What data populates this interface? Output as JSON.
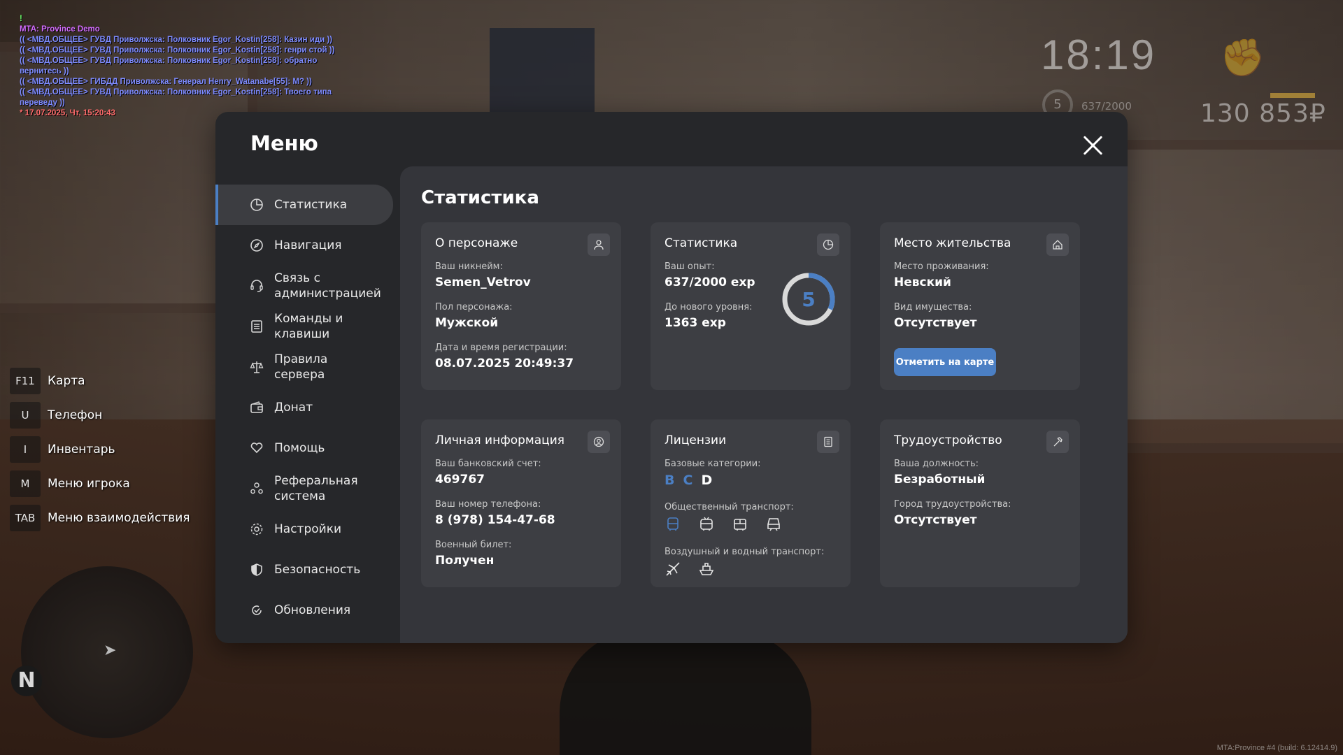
{
  "chat": {
    "lines": [
      {
        "text": "!",
        "color": "green"
      },
      {
        "text": "MTA: Province Demo",
        "color": "title"
      },
      {
        "text": "(( <МВД.ОБЩЕЕ> ГУВД Приволжска: Полковник Egor_Kostin[258]: Казин иди ))",
        "color": "blue"
      },
      {
        "text": "(( <МВД.ОБЩЕЕ> ГУВД Приволжска: Полковник Egor_Kostin[258]: генри стой ))",
        "color": "blue"
      },
      {
        "text": "(( <МВД.ОБЩЕЕ> ГУВД Приволжска: Полковник Egor_Kostin[258]: обратно вернитесь ))",
        "color": "blue"
      },
      {
        "text": "(( <МВД.ОБЩЕЕ> ГИБДД Приволжска: Генерал Henry_Watanabe[55]: М? ))",
        "color": "blue"
      },
      {
        "text": "(( <МВД.ОБЩЕЕ> ГУВД Приволжска: Полковник Egor_Kostin[258]: Твоего типа переведу ))",
        "color": "blue"
      },
      {
        "text": "* 17.07.2025, Чт, 15:20:43",
        "color": "red"
      }
    ]
  },
  "hud": {
    "time": "18:19",
    "level": "5",
    "exp": "637/2000",
    "money": "130 853₽",
    "fist_icon": "fist-icon"
  },
  "shortcuts": [
    {
      "key": "F11",
      "label": "Карта"
    },
    {
      "key": "U",
      "label": "Телефон"
    },
    {
      "key": "I",
      "label": "Инвентарь"
    },
    {
      "key": "M",
      "label": "Меню игрока"
    },
    {
      "key": "TAB",
      "label": "Меню взаимодействия"
    }
  ],
  "minimap": {
    "north": "N"
  },
  "build": "MTA:Province #4 (build: 6.12414.9)",
  "menu": {
    "title": "Меню",
    "nav": [
      {
        "label": "Статистика",
        "icon": "pie-chart-icon",
        "active": true
      },
      {
        "label": "Навигация",
        "icon": "compass-icon"
      },
      {
        "label": "Связь с администрацией",
        "icon": "headset-icon"
      },
      {
        "label": "Команды и клавиши",
        "icon": "list-icon"
      },
      {
        "label": "Правила сервера",
        "icon": "scales-icon"
      },
      {
        "label": "Донат",
        "icon": "wallet-icon"
      },
      {
        "label": "Помощь",
        "icon": "heart-hands-icon"
      },
      {
        "label": "Реферальная система",
        "icon": "people-icon"
      },
      {
        "label": "Настройки",
        "icon": "gear-icon"
      },
      {
        "label": "Безопасность",
        "icon": "shield-icon"
      },
      {
        "label": "Обновления",
        "icon": "refresh-icon"
      }
    ],
    "content_title": "Статистика",
    "character": {
      "title": "О персонаже",
      "nick_label": "Ваш никнейм:",
      "nick": "Semen_Vetrov",
      "gender_label": "Пол персонажа:",
      "gender": "Мужской",
      "reg_label": "Дата и время регистрации:",
      "reg": "08.07.2025 20:49:37"
    },
    "stats": {
      "title": "Статистика",
      "exp_label": "Ваш опыт:",
      "exp": "637/2000 exp",
      "next_label": "До нового уровня:",
      "next": "1363 exp",
      "level": "5",
      "progress": 0.3185,
      "ring_color": "#4b7fc4"
    },
    "residence": {
      "title": "Место жительства",
      "place_label": "Место проживания:",
      "place": "Невский",
      "property_label": "Вид имущества:",
      "property": "Отсутствует",
      "button": "Отметить на карте"
    },
    "personal": {
      "title": "Личная информация",
      "bank_label": "Ваш банковский счет:",
      "bank": "469767",
      "phone_label": "Ваш номер телефона:",
      "phone": "8 (978) 154-47-68",
      "military_label": "Военный билет:",
      "military": "Получен"
    },
    "licenses": {
      "title": "Лицензии",
      "base_label": "Базовые категории:",
      "categories": [
        {
          "letter": "B",
          "color": "#4b7fc4"
        },
        {
          "letter": "C",
          "color": "#4b7fc4"
        },
        {
          "letter": "D",
          "color": "#ffffff"
        }
      ],
      "public_label": "Общественный транспорт:",
      "public_icons": [
        "bus-icon",
        "trolleybus-icon",
        "tram-icon",
        "train-icon"
      ],
      "air_label": "Воздушный и водный транспорт:",
      "air_icons": [
        "plane-icon",
        "ship-icon"
      ]
    },
    "job": {
      "title": "Трудоустройство",
      "position_label": "Ваша должность:",
      "position": "Безработный",
      "city_label": "Город трудоустройства:",
      "city": "Отсутствует"
    }
  }
}
